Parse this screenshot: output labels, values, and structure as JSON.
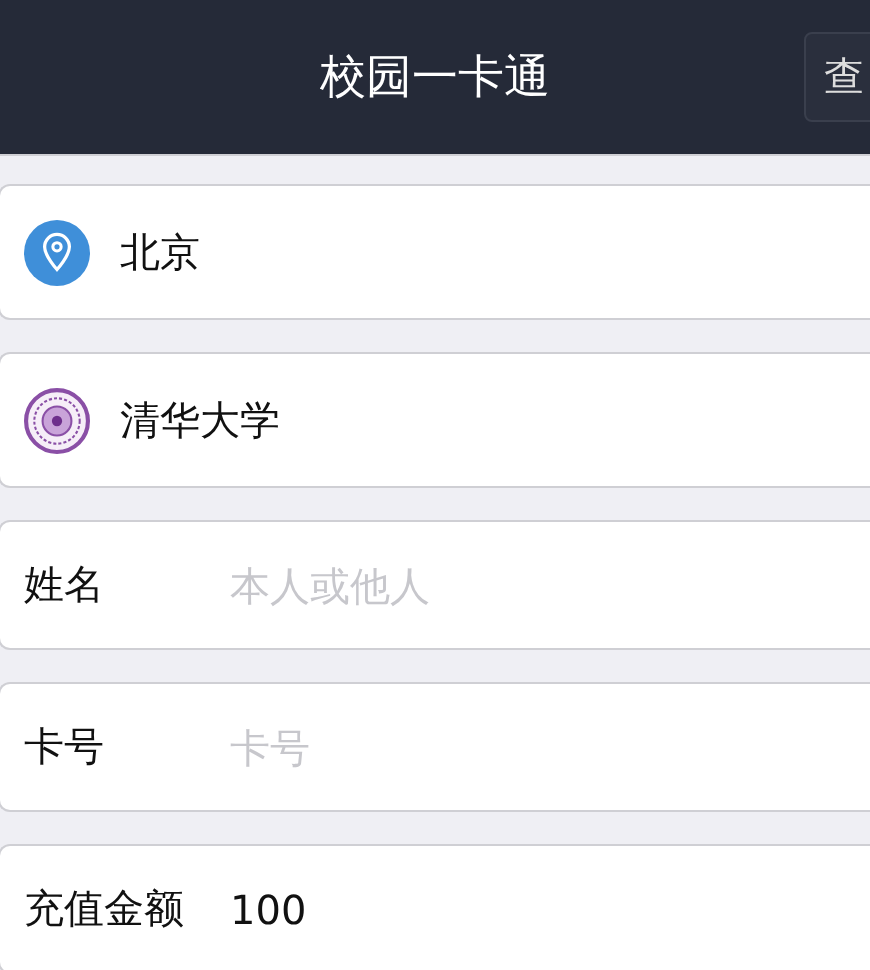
{
  "header": {
    "title": "校园一卡通",
    "action": "查"
  },
  "rows": [
    {
      "kind": "location",
      "text": "北京"
    },
    {
      "kind": "school",
      "text": "清华大学"
    },
    {
      "kind": "field",
      "label": "姓名",
      "placeholder": "本人或他人"
    },
    {
      "kind": "field",
      "label": "卡号",
      "placeholder": "卡号"
    },
    {
      "kind": "field",
      "label": "充值金额",
      "value": "100"
    }
  ]
}
